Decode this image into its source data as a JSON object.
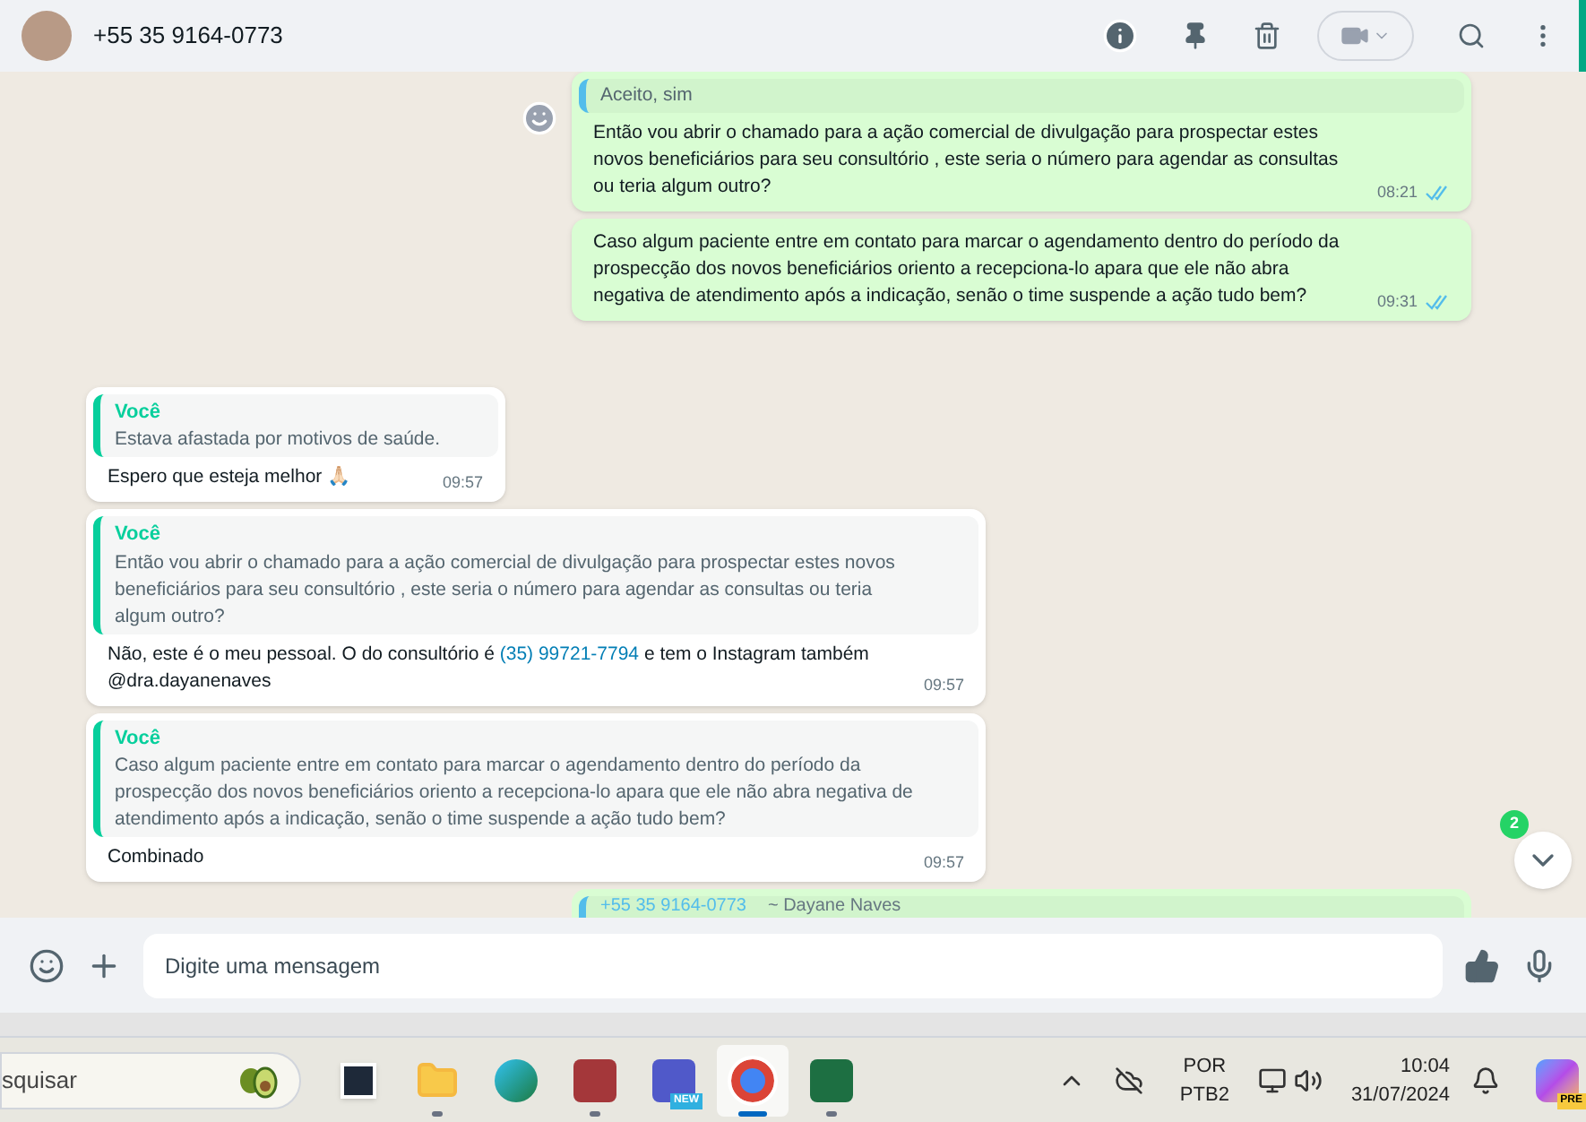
{
  "header": {
    "contact": "+55 35 9164-0773"
  },
  "messages": [
    {
      "kind": "out",
      "quote": {
        "text": "Aceito, sim"
      },
      "parts": [
        {
          "kind": "plain",
          "text": "Então vou abrir o chamado para a ação comercial de divulgação para prospectar estes novos beneficiários para seu consultório , este seria o número para agendar as consultas ou teria algum outro?"
        }
      ],
      "time": "08:21",
      "read": true,
      "react_button": true
    },
    {
      "kind": "out",
      "parts": [
        {
          "kind": "plain",
          "text": "Caso algum paciente entre em contato para marcar o agendamento dentro do período da prospecção dos novos beneficiários oriento a recepciona-lo apara que ele não abra negativa de atendimento após a indicação, senão o time suspende a ação tudo bem?"
        }
      ],
      "time": "09:31",
      "read": true,
      "react_button": false
    },
    {
      "kind": "in",
      "quote": {
        "author": "Você",
        "text": "Estava afastada por motivos de saúde."
      },
      "parts": [
        {
          "kind": "plain",
          "text": "Espero que esteja melhor 🙏🏻"
        }
      ],
      "time": "09:57",
      "react_button": false
    },
    {
      "kind": "in",
      "quote": {
        "author": "Você",
        "text": "Então vou abrir o chamado para a ação comercial de divulgação para prospectar estes novos beneficiários para seu consultório , este seria o número para agendar as consultas ou teria algum outro?"
      },
      "parts": [
        {
          "kind": "plain",
          "text": "Não, este é o meu pessoal. O do consultório é "
        },
        {
          "kind": "link",
          "text": "(35) 99721-7794"
        },
        {
          "kind": "plain",
          "text": " e tem o Instagram também @dra.dayanenaves"
        }
      ],
      "time": "09:57",
      "react_button": false
    },
    {
      "kind": "in",
      "quote": {
        "author": "Você",
        "text": "Caso algum paciente entre em contato para marcar o agendamento dentro do período da prospecção dos novos beneficiários oriento a recepciona-lo apara que ele não abra negativa de atendimento após a indicação, senão o time suspende a ação tudo bem?"
      },
      "parts": [
        {
          "kind": "plain",
          "text": "Combinado"
        }
      ],
      "time": "09:57",
      "react_button": false
    }
  ],
  "partial_message": {
    "quote_author": "+55 35 9164-0773",
    "quote_name": "~ Dayane Naves"
  },
  "unread_badge": "2",
  "composer": {
    "placeholder": "Digite uma mensagem"
  },
  "taskbar": {
    "search": {
      "value": "squisar"
    },
    "apps": [
      {
        "kind": "taskview",
        "selected": false,
        "running": false
      },
      {
        "kind": "explorer",
        "selected": false,
        "running": true
      },
      {
        "kind": "edge",
        "selected": false,
        "running": false
      },
      {
        "kind": "access",
        "selected": false,
        "running": true
      },
      {
        "kind": "teams",
        "selected": false,
        "running": false,
        "badge": "NEW"
      },
      {
        "kind": "chrome",
        "selected": true,
        "running": true
      },
      {
        "kind": "excel",
        "selected": false,
        "running": true
      }
    ],
    "language": "POR",
    "layout": "PTB2",
    "time": "10:04",
    "date": "31/07/2024",
    "copilot_badge": "PRE"
  }
}
